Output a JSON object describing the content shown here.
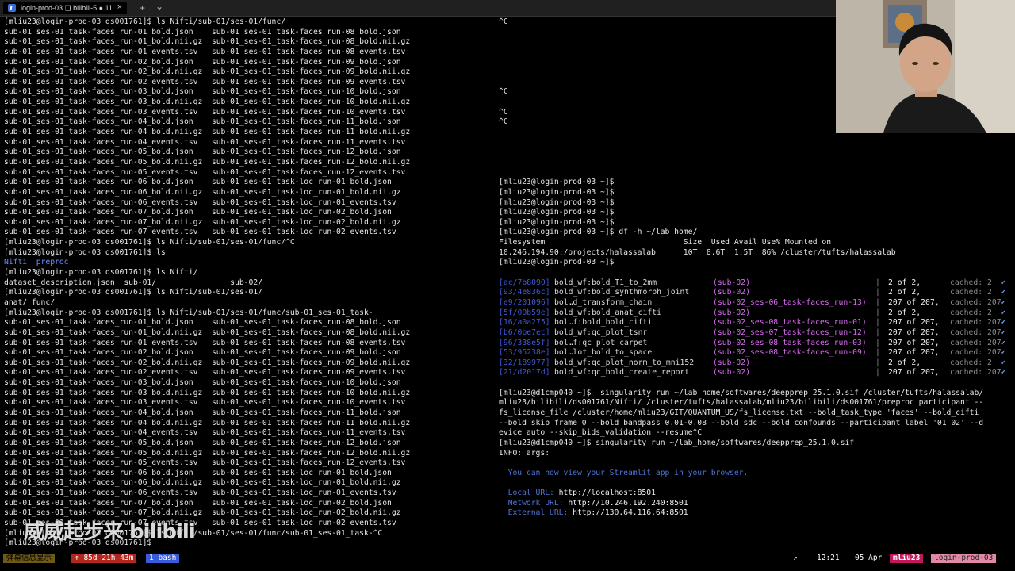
{
  "window": {
    "tab_title": "login-prod-03 ❏ bilibili-5 ● 11",
    "close_glyph": "×",
    "new_tab_glyph": "+",
    "dropdown_glyph": "⌄"
  },
  "left_pane": {
    "lines": [
      "[mliu23@login-prod-03 ds001761]$ ls Nifti/sub-01/ses-01/func/",
      "sub-01_ses-01_task-faces_run-01_bold.json    sub-01_ses-01_task-faces_run-08_bold.json",
      "sub-01_ses-01_task-faces_run-01_bold.nii.gz  sub-01_ses-01_task-faces_run-08_bold.nii.gz",
      "sub-01_ses-01_task-faces_run-01_events.tsv   sub-01_ses-01_task-faces_run-08_events.tsv",
      "sub-01_ses-01_task-faces_run-02_bold.json    sub-01_ses-01_task-faces_run-09_bold.json",
      "sub-01_ses-01_task-faces_run-02_bold.nii.gz  sub-01_ses-01_task-faces_run-09_bold.nii.gz",
      "sub-01_ses-01_task-faces_run-02_events.tsv   sub-01_ses-01_task-faces_run-09_events.tsv",
      "sub-01_ses-01_task-faces_run-03_bold.json    sub-01_ses-01_task-faces_run-10_bold.json",
      "sub-01_ses-01_task-faces_run-03_bold.nii.gz  sub-01_ses-01_task-faces_run-10_bold.nii.gz",
      "sub-01_ses-01_task-faces_run-03_events.tsv   sub-01_ses-01_task-faces_run-10_events.tsv",
      "sub-01_ses-01_task-faces_run-04_bold.json    sub-01_ses-01_task-faces_run-11_bold.json",
      "sub-01_ses-01_task-faces_run-04_bold.nii.gz  sub-01_ses-01_task-faces_run-11_bold.nii.gz",
      "sub-01_ses-01_task-faces_run-04_events.tsv   sub-01_ses-01_task-faces_run-11_events.tsv",
      "sub-01_ses-01_task-faces_run-05_bold.json    sub-01_ses-01_task-faces_run-12_bold.json",
      "sub-01_ses-01_task-faces_run-05_bold.nii.gz  sub-01_ses-01_task-faces_run-12_bold.nii.gz",
      "sub-01_ses-01_task-faces_run-05_events.tsv   sub-01_ses-01_task-faces_run-12_events.tsv",
      "sub-01_ses-01_task-faces_run-06_bold.json    sub-01_ses-01_task-loc_run-01_bold.json",
      "sub-01_ses-01_task-faces_run-06_bold.nii.gz  sub-01_ses-01_task-loc_run-01_bold.nii.gz",
      "sub-01_ses-01_task-faces_run-06_events.tsv   sub-01_ses-01_task-loc_run-01_events.tsv",
      "sub-01_ses-01_task-faces_run-07_bold.json    sub-01_ses-01_task-loc_run-02_bold.json",
      "sub-01_ses-01_task-faces_run-07_bold.nii.gz  sub-01_ses-01_task-loc_run-02_bold.nii.gz",
      "sub-01_ses-01_task-faces_run-07_events.tsv   sub-01_ses-01_task-loc_run-02_events.tsv",
      "[mliu23@login-prod-03 ds001761]$ ls Nifti/sub-01/ses-01/func/^C",
      "[mliu23@login-prod-03 ds001761]$ ls",
      "Nifti  preproc",
      "[mliu23@login-prod-03 ds001761]$ ls Nifti/",
      "dataset_description.json  sub-01/                sub-02/",
      "[mliu23@login-prod-03 ds001761]$ ls Nifti/sub-01/ses-01/",
      "anat/ func/",
      "[mliu23@login-prod-03 ds001761]$ ls Nifti/sub-01/ses-01/func/sub-01_ses-01_task-",
      "sub-01_ses-01_task-faces_run-01_bold.json    sub-01_ses-01_task-faces_run-08_bold.json",
      "sub-01_ses-01_task-faces_run-01_bold.nii.gz  sub-01_ses-01_task-faces_run-08_bold.nii.gz",
      "sub-01_ses-01_task-faces_run-01_events.tsv   sub-01_ses-01_task-faces_run-08_events.tsv",
      "sub-01_ses-01_task-faces_run-02_bold.json    sub-01_ses-01_task-faces_run-09_bold.json",
      "sub-01_ses-01_task-faces_run-02_bold.nii.gz  sub-01_ses-01_task-faces_run-09_bold.nii.gz",
      "sub-01_ses-01_task-faces_run-02_events.tsv   sub-01_ses-01_task-faces_run-09_events.tsv",
      "sub-01_ses-01_task-faces_run-03_bold.json    sub-01_ses-01_task-faces_run-10_bold.json",
      "sub-01_ses-01_task-faces_run-03_bold.nii.gz  sub-01_ses-01_task-faces_run-10_bold.nii.gz",
      "sub-01_ses-01_task-faces_run-03_events.tsv   sub-01_ses-01_task-faces_run-10_events.tsv",
      "sub-01_ses-01_task-faces_run-04_bold.json    sub-01_ses-01_task-faces_run-11_bold.json",
      "sub-01_ses-01_task-faces_run-04_bold.nii.gz  sub-01_ses-01_task-faces_run-11_bold.nii.gz",
      "sub-01_ses-01_task-faces_run-04_events.tsv   sub-01_ses-01_task-faces_run-11_events.tsv",
      "sub-01_ses-01_task-faces_run-05_bold.json    sub-01_ses-01_task-faces_run-12_bold.json",
      "sub-01_ses-01_task-faces_run-05_bold.nii.gz  sub-01_ses-01_task-faces_run-12_bold.nii.gz",
      "sub-01_ses-01_task-faces_run-05_events.tsv   sub-01_ses-01_task-faces_run-12_events.tsv",
      "sub-01_ses-01_task-faces_run-06_bold.json    sub-01_ses-01_task-loc_run-01_bold.json",
      "sub-01_ses-01_task-faces_run-06_bold.nii.gz  sub-01_ses-01_task-loc_run-01_bold.nii.gz",
      "sub-01_ses-01_task-faces_run-06_events.tsv   sub-01_ses-01_task-loc_run-01_events.tsv",
      "sub-01_ses-01_task-faces_run-07_bold.json    sub-01_ses-01_task-loc_run-02_bold.json",
      "sub-01_ses-01_task-faces_run-07_bold.nii.gz  sub-01_ses-01_task-loc_run-02_bold.nii.gz",
      "sub-01_ses-01_task-faces_run-07_events.tsv   sub-01_ses-01_task-loc_run-02_events.tsv",
      "[mliu23@login-prod-03 ds001761]$ ls Nifti/sub-01/ses-01/func/sub-01_ses-01_task-^C",
      "[mliu23@login-prod-03 ds001761]$ "
    ],
    "highlight_line_index": 24
  },
  "right_pane": {
    "top_lines": [
      "^C",
      "",
      "",
      "",
      "",
      "",
      "",
      "^C",
      "",
      "^C",
      "^C",
      "",
      "",
      "",
      "",
      "",
      "[mliu23@login-prod-03 ~]$",
      "[mliu23@login-prod-03 ~]$",
      "[mliu23@login-prod-03 ~]$",
      "[mliu23@login-prod-03 ~]$",
      "[mliu23@login-prod-03 ~]$",
      "[mliu23@login-prod-03 ~]$ df -h ~/lab_home/",
      "Filesystem                              Size  Used Avail Use% Mounted on",
      "10.246.194.90:/projects/halassalab      10T  8.6T  1.5T  86% /cluster/tufts/halassalab",
      "[mliu23@login-prod-03 ~]$",
      ""
    ],
    "tasks": [
      {
        "hash": "[ac/7b8090]",
        "name": "bold_wf:bold_T1_to_2mm",
        "arg": "(sub-02)",
        "count": "2 of 2,",
        "cached": "cached: 2",
        "check": "✔"
      },
      {
        "hash": "[93/4e836c]",
        "name": "bold_wf:bold_synthmorph_joint",
        "arg": "(sub-02)",
        "count": "2 of 2,",
        "cached": "cached: 2",
        "check": "✔"
      },
      {
        "hash": "[e9/201096]",
        "name": "bol…d_transform_chain",
        "arg": "(sub-02_ses-06_task-faces_run-13)",
        "count": "207 of 207,",
        "cached": "cached: 207",
        "check": "✔"
      },
      {
        "hash": "[5f/00b59e]",
        "name": "bold_wf:bold_anat_cifti",
        "arg": "(sub-02)",
        "count": "2 of 2,",
        "cached": "cached: 2",
        "check": "✔"
      },
      {
        "hash": "[16/a0a275]",
        "name": "bol…f:bold_bold_cifti",
        "arg": "(sub-02_ses-08_task-faces_run-01)",
        "count": "207 of 207,",
        "cached": "cached: 207",
        "check": "✔"
      },
      {
        "hash": "[b6/0be7ec]",
        "name": "bold_wf:qc_plot_tsnr",
        "arg": "(sub-02_ses-07_task-faces_run-12)",
        "count": "207 of 207,",
        "cached": "cached: 207",
        "check": "✔"
      },
      {
        "hash": "[96/338e5f]",
        "name": "bol…f:qc_plot_carpet",
        "arg": "(sub-02_ses-08_task-faces_run-03)",
        "count": "207 of 207,",
        "cached": "cached: 207",
        "check": "✔"
      },
      {
        "hash": "[53/95238e]",
        "name": "bol…lot_bold_to_space",
        "arg": "(sub-02_ses-08_task-faces_run-09)",
        "count": "207 of 207,",
        "cached": "cached: 207",
        "check": "✔"
      },
      {
        "hash": "[32/189977]",
        "name": "bold_wf:qc_plot_norm_to_mni152",
        "arg": "(sub-02)",
        "count": "2 of 2,",
        "cached": "cached: 2",
        "check": "✔"
      },
      {
        "hash": "[21/d2017d]",
        "name": "bold_wf:qc_bold_create_report",
        "arg": "(sub-02)",
        "count": "207 of 207,",
        "cached": "cached: 207",
        "check": "✔"
      }
    ],
    "bottom_lines": [
      "",
      "[mliu23@d1cmp040 ~]$  singularity run ~/lab_home/softwares/deepprep_25.1.0.sif /cluster/tufts/halassalab/",
      "mliu23/bilibili/ds001761/Nifti/ /cluster/tufts/halassalab/mliu23/bilibili/ds001761/preproc participant --",
      "fs_license_file /cluster/home/mliu23/GIT/QUANTUM_US/fs_license.txt --bold_task_type 'faces' --bold_cifti",
      "--bold_skip_frame 0 --bold_bandpass 0.01-0.08 --bold_sdc --bold_confounds --participant_label '01 02' --d",
      "evice auto --skip_bids_validation --resume^C",
      "[mliu23@d1cmp040 ~]$ singularity run ~/lab_home/softwares/deepprep_25.1.0.sif",
      "INFO: args:",
      ""
    ],
    "streamlit_msg": "  You can now view your Streamlit app in your browser.",
    "urls": [
      {
        "label": "  Local URL: ",
        "value": "http://localhost:8501"
      },
      {
        "label": "  Network URL: ",
        "value": "http://10.246.192.240:8501"
      },
      {
        "label": "  External URL: ",
        "value": "http://130.64.116.64:8501"
      }
    ]
  },
  "statusbar": {
    "left_session": "弹幕信息显示",
    "uptime": "↑ 85d 21h 43m",
    "window": "1 bash",
    "arrow": "↗",
    "time": "12:21",
    "date": "05 Apr",
    "user": "mliu23",
    "host": "login-prod-03"
  },
  "watermark": {
    "text": "威威起步来 bilibili"
  },
  "colors": {
    "terminal_bg": "#000000",
    "pink_status": "#c2185b",
    "blue_status": "#3a5bd9",
    "red_status": "#b3261e",
    "yellow_status": "#c9a227"
  }
}
